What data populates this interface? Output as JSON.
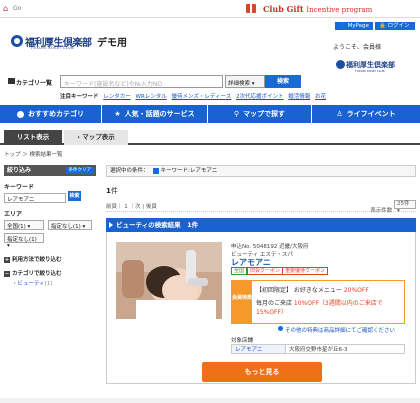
{
  "top": {
    "go_text": "Go",
    "brand": "Club Gift",
    "brand_sub": "Incentive program"
  },
  "header": {
    "logo_title": "福利厚生倶楽部",
    "logo_sub": "FUKURI KOSEI CLUB",
    "demo_label": "デモ用",
    "mypage_label": "MyPage",
    "login_label": "ログイン",
    "welcome": "ようこそ、会員様"
  },
  "search": {
    "category_label": "カテゴリ一覧",
    "placeholder": "キーワード(施設名など)や№入力NO",
    "select_label": "詳細検索",
    "button_label": "検索",
    "attention_label": "注目キーワード",
    "keywords": [
      "レンタカー",
      "WRレンタル",
      "優待メンズ・レディース",
      "2次代応援ポイント",
      "婚活情報",
      "お花"
    ]
  },
  "logo2": {
    "title": "福利厚生倶楽部",
    "sub": "FUKURI KOSEI CLUB"
  },
  "nav": [
    "おすすめカテゴリ",
    "人気・話題のサービス",
    "マップで探す",
    "ライフイベント"
  ],
  "tabs": {
    "list": "リスト表示",
    "map": "マップ表示"
  },
  "breadcrumb": "トップ ＞ 検索結果一覧",
  "sidebar": {
    "title": "絞り込み",
    "clear": "条件クリア",
    "keyword_label": "キーワード",
    "keyword_value": "レアモアニ",
    "keyword_btn": "検索",
    "area_label": "エリア",
    "area_sel1": "全国(1)",
    "area_sel2": "指定なし(1)",
    "area_sel3": "指定なし(1)",
    "usage_filter": "利用方法で絞り込む",
    "category_filter": "カテゴリで絞り込む",
    "category_item": "・ビューティ",
    "category_item_count": "(1)"
  },
  "main": {
    "selected_label": "選択中の条件：",
    "selected_value": "キーワード:レアモアニ",
    "count": "1",
    "count_unit": "件",
    "pager": "前頁｜ 1 ｜次 | 後頁",
    "per_page_label": "表示件数",
    "per_page_value": "25件",
    "result_title": "ビューティの検索結果　1件"
  },
  "shop": {
    "no": "申込No. 5048192 近畿/大阪府",
    "category": "ビューティ エステ・スパ",
    "name": "レアモアニ",
    "tags": [
      "全国",
      "旧会クーポン",
      "重要優待クーポン"
    ],
    "offer_badge": "会員特典",
    "offer_line1_a": "【初回限定】 お好きなメニュー ",
    "offer_line1_b": "20%OFF",
    "offer_line2_a": "毎月のご来店 ",
    "offer_line2_b": "10%OFF（3週間以内のご来店で15%OFF）",
    "other_menu": "その他の特典は商品詳細にてご確認ください",
    "store_label": "対象店舗",
    "store_name": "レアモアニ",
    "store_address": "大阪府交野市星が丘6-3"
  },
  "more_button": "もっと見る",
  "colors": {
    "nav_blue": "#1a62cf",
    "accent_orange": "#f07018",
    "brand_red": "#c8321e"
  }
}
